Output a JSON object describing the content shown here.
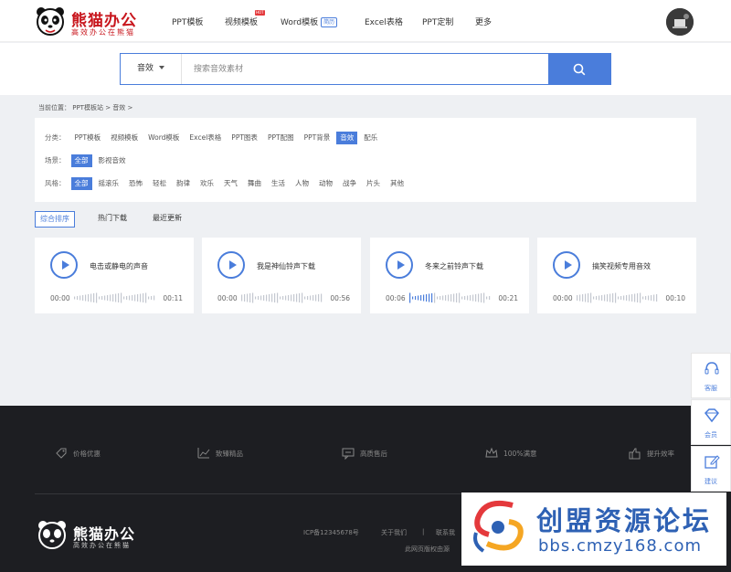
{
  "brand": {
    "name": "熊猫办公",
    "slogan": "高效办公在熊猫"
  },
  "nav": [
    {
      "label": "PPT模板"
    },
    {
      "label": "视频模板",
      "badge": "HOT"
    },
    {
      "label": "Word模板",
      "badge": "简历"
    },
    {
      "label": "Excel表格"
    },
    {
      "label": "PPT定制"
    },
    {
      "label": "更多"
    }
  ],
  "search": {
    "category": "音效",
    "placeholder": "搜索音效素材"
  },
  "breadcrumb": {
    "prefix": "当前位置：",
    "items": [
      "PPT模板站",
      ">",
      "音效",
      ">"
    ]
  },
  "filters": {
    "category": {
      "label": "分类：",
      "options": [
        "PPT模板",
        "视频模板",
        "Word模板",
        "Excel表格",
        "PPT图表",
        "PPT配图",
        "PPT背景",
        "音效",
        "配乐"
      ],
      "active": "音效"
    },
    "scene": {
      "label": "场景：",
      "options": [
        "全部",
        "影视音效"
      ],
      "active": "全部"
    },
    "style": {
      "label": "风格：",
      "options": [
        "全部",
        "摇滚乐",
        "恐怖",
        "轻松",
        "韵律",
        "欢乐",
        "天气",
        "舞曲",
        "生活",
        "人物",
        "动物",
        "战争",
        "片头",
        "其他"
      ],
      "active": "全部"
    }
  },
  "sort": {
    "options": [
      "综合排序",
      "热门下载",
      "最近更新"
    ],
    "active": "综合排序"
  },
  "sounds": [
    {
      "title": "电击或静电的声音",
      "current": "00:00",
      "duration": "00:11",
      "progress": 0
    },
    {
      "title": "我是神仙铃声下载",
      "current": "00:00",
      "duration": "00:56",
      "progress": 0
    },
    {
      "title": "冬来之前铃声下载",
      "current": "00:06",
      "duration": "00:21",
      "progress": 0.28
    },
    {
      "title": "搞笑视频专用音效",
      "current": "00:00",
      "duration": "00:10",
      "progress": 0
    }
  ],
  "side_tools": [
    {
      "label": "客服",
      "icon": "headset-icon"
    },
    {
      "label": "会员",
      "icon": "diamond-icon"
    },
    {
      "label": "建议",
      "icon": "edit-icon"
    }
  ],
  "footer": {
    "features": [
      {
        "label": "价格优惠",
        "icon": "tag-icon"
      },
      {
        "label": "致臻精品",
        "icon": "chart-icon"
      },
      {
        "label": "高质售后",
        "icon": "chat-icon"
      },
      {
        "label": "100%满意",
        "icon": "crown-icon"
      },
      {
        "label": "提升效率",
        "icon": "thumbs-up-icon"
      }
    ],
    "icp": "ICP备12345678号",
    "links": [
      "关于我们",
      "联系我"
    ],
    "separator": "|",
    "copyright": "此网页版权由源"
  },
  "watermark": {
    "title": "创盟资源论坛",
    "url": "bbs.cmzy168.com"
  },
  "colors": {
    "accent": "#4a7ddb",
    "brand_red": "#c8161d",
    "footer_bg": "#1d1e22"
  }
}
